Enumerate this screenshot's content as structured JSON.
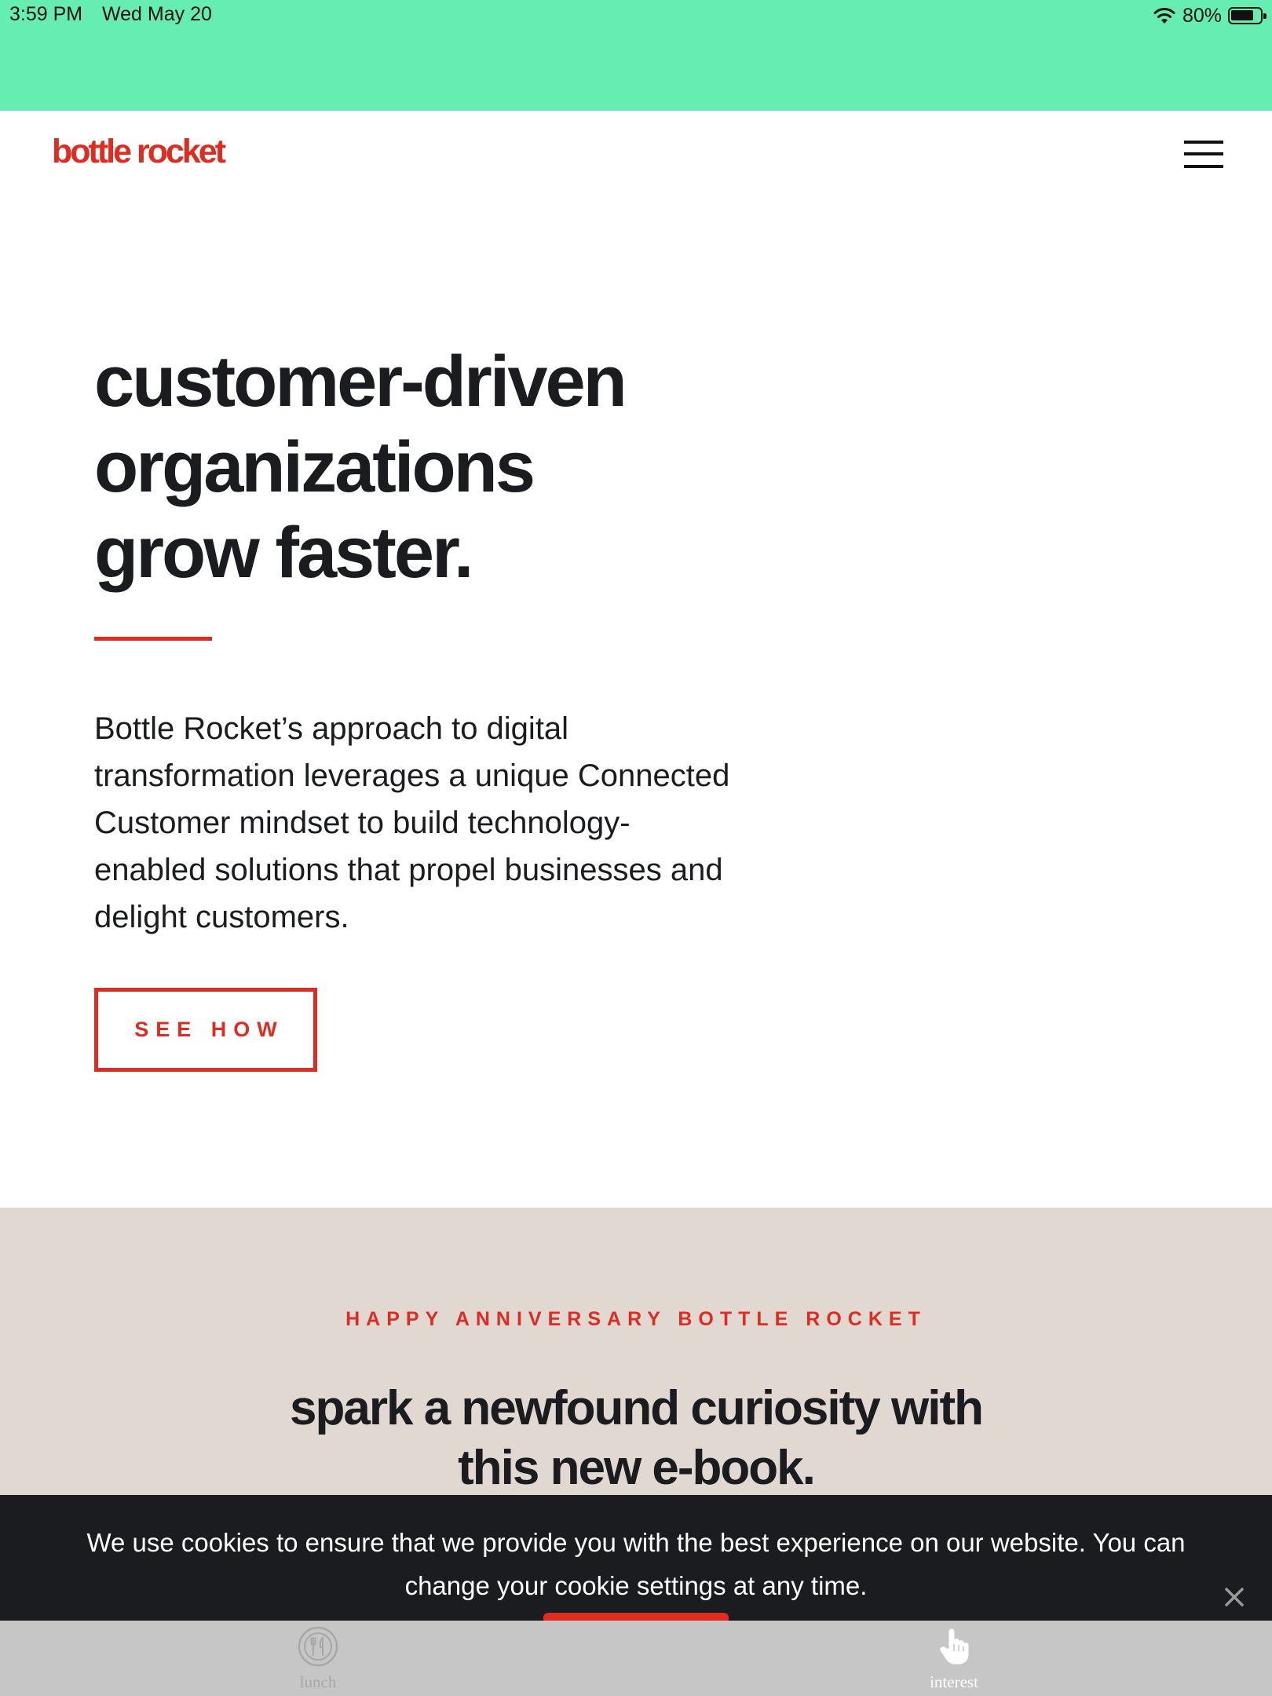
{
  "status_bar": {
    "time": "3:59 PM",
    "date": "Wed May 20",
    "battery": "80%",
    "battery_level": 0.8,
    "background": "#66edb2"
  },
  "header": {
    "logo_text": "bottle rocket",
    "menu_icon": "hamburger-menu-icon"
  },
  "hero": {
    "title_lines": [
      "customer-driven",
      "organizations",
      "grow faster."
    ],
    "body_lines": [
      "Bottle Rocket’s approach to digital",
      "transformation leverages a unique Connected",
      "Customer mindset to build technology-",
      "enabled solutions that propel businesses and",
      "delight customers."
    ],
    "cta_label": "SEE HOW"
  },
  "anniversary": {
    "eyebrow": "HAPPY ANNIVERSARY BOTTLE ROCKET",
    "title_lines": [
      "spark a newfound curiosity with",
      "this new e-book."
    ],
    "background": "#e1d8d2"
  },
  "cookie_banner": {
    "text_lines": [
      "We use cookies to ensure that we provide you with the best experience on our website. You can",
      "change your cookie settings at any time."
    ],
    "close_icon": "close-icon",
    "background": "#1b1c1f"
  },
  "bottom_bar": {
    "tabs": [
      {
        "label": "lunch",
        "icon": "fork-knife-icon"
      },
      {
        "label": "interest",
        "icon": "hand-pointer-icon"
      }
    ]
  },
  "colors": {
    "accent": "#e02b20",
    "text": "#1b1c1f"
  }
}
